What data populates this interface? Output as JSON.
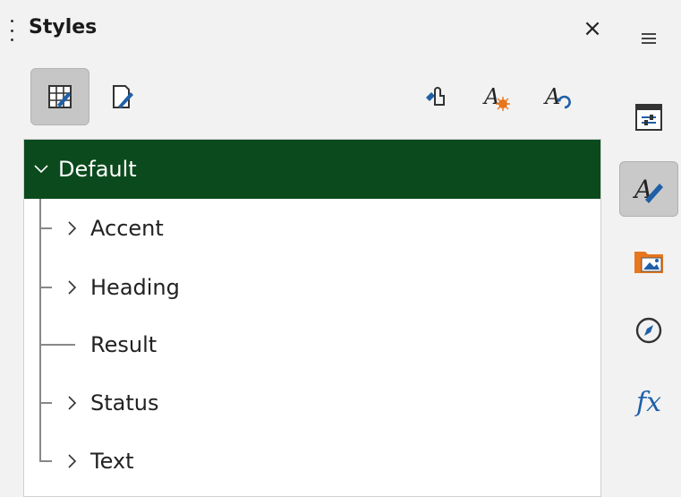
{
  "panel": {
    "title": "Styles",
    "close_symbol": "×"
  },
  "toolbar": {
    "buttons": [
      {
        "icon": "cell-styles-icon",
        "active": true
      },
      {
        "icon": "page-styles-icon",
        "active": false
      },
      {
        "icon": "fill-format-mode-icon",
        "active": false
      },
      {
        "icon": "new-style-from-selection-icon",
        "active": false
      },
      {
        "icon": "update-style-icon",
        "active": false
      }
    ]
  },
  "tree": {
    "root": {
      "label": "Default",
      "expanded": true
    },
    "children": [
      {
        "label": "Accent",
        "has_children": true
      },
      {
        "label": "Heading",
        "has_children": true
      },
      {
        "label": "Result",
        "has_children": false
      },
      {
        "label": "Status",
        "has_children": true
      },
      {
        "label": "Text",
        "has_children": true
      }
    ]
  },
  "sidebar": {
    "items": [
      {
        "icon": "menu-icon"
      },
      {
        "icon": "properties-icon"
      },
      {
        "icon": "styles-icon",
        "active": true
      },
      {
        "icon": "gallery-icon"
      },
      {
        "icon": "navigator-icon"
      },
      {
        "icon": "functions-icon",
        "label": "fx"
      }
    ]
  },
  "colors": {
    "selection": "#0b4a1d",
    "accent_blue": "#1f5fa8",
    "accent_orange": "#e8761c"
  }
}
